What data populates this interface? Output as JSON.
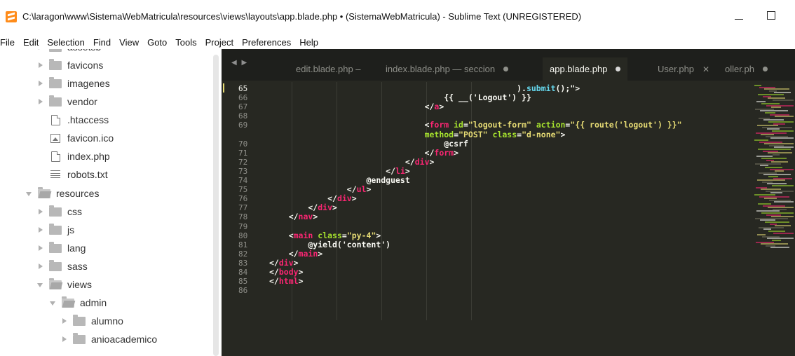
{
  "window": {
    "title": "C:\\laragon\\www\\SistemaWebMatricula\\resources\\views\\layouts\\app.blade.php • (SistemaWebMatricula) - Sublime Text (UNREGISTERED)"
  },
  "menu": [
    "File",
    "Edit",
    "Selection",
    "Find",
    "View",
    "Goto",
    "Tools",
    "Project",
    "Preferences",
    "Help"
  ],
  "sidebar": {
    "items": [
      {
        "label": "assetsb",
        "kind": "folder",
        "state": "collapsed"
      },
      {
        "label": "favicons",
        "kind": "folder",
        "state": "collapsed"
      },
      {
        "label": "imagenes",
        "kind": "folder",
        "state": "collapsed"
      },
      {
        "label": "vendor",
        "kind": "folder",
        "state": "collapsed"
      },
      {
        "label": ".htaccess",
        "kind": "file"
      },
      {
        "label": "favicon.ico",
        "kind": "image"
      },
      {
        "label": "index.php",
        "kind": "file"
      },
      {
        "label": "robots.txt",
        "kind": "text"
      },
      {
        "label": "resources",
        "kind": "folder",
        "state": "expanded"
      },
      {
        "label": "css",
        "kind": "folder",
        "state": "collapsed"
      },
      {
        "label": "js",
        "kind": "folder",
        "state": "collapsed"
      },
      {
        "label": "lang",
        "kind": "folder",
        "state": "collapsed"
      },
      {
        "label": "sass",
        "kind": "folder",
        "state": "collapsed"
      },
      {
        "label": "views",
        "kind": "folder",
        "state": "expanded"
      },
      {
        "label": "admin",
        "kind": "folder",
        "state": "expanded"
      },
      {
        "label": "alumno",
        "kind": "folder",
        "state": "collapsed"
      },
      {
        "label": "anioacademico",
        "kind": "folder",
        "state": "collapsed"
      }
    ]
  },
  "tabs": [
    {
      "label": "edit.blade.php –",
      "active": false,
      "marker": ""
    },
    {
      "label": "index.blade.php — seccion",
      "active": false,
      "marker": "dot"
    },
    {
      "label": "app.blade.php",
      "active": true,
      "marker": "dot"
    },
    {
      "label": "User.php",
      "active": false,
      "marker": "close"
    },
    {
      "label": "oller.ph",
      "active": false,
      "marker": "dot"
    }
  ],
  "tab_nav": "◀ ▶",
  "editor": {
    "line_numbers": [
      "65",
      "66",
      "67",
      "68",
      "69",
      "",
      "70",
      "71",
      "72",
      "73",
      "74",
      "75",
      "76",
      "77",
      "78",
      "79",
      "80",
      "81",
      "82",
      "83",
      "84",
      "85",
      "86"
    ],
    "current_line": "65",
    "lines": [
      [
        {
          "t": "                                                   ).",
          "c": ""
        },
        {
          "t": "submit",
          "c": "fn"
        },
        {
          "t": "();\">",
          "c": ""
        }
      ],
      [
        {
          "t": "                                    {{ __('Logout') }}",
          "c": ""
        }
      ],
      [
        {
          "t": "                                ",
          "c": ""
        },
        {
          "t": "</",
          "c": ""
        },
        {
          "t": "a",
          "c": "tag"
        },
        {
          "t": ">",
          "c": ""
        }
      ],
      [
        {
          "t": "",
          "c": ""
        }
      ],
      [
        {
          "t": "                                <",
          "c": ""
        },
        {
          "t": "form",
          "c": "tag"
        },
        {
          "t": " ",
          "c": ""
        },
        {
          "t": "id",
          "c": "attr"
        },
        {
          "t": "=",
          "c": ""
        },
        {
          "t": "\"logout-form\"",
          "c": "str"
        },
        {
          "t": " ",
          "c": ""
        },
        {
          "t": "action",
          "c": "attr"
        },
        {
          "t": "=",
          "c": ""
        },
        {
          "t": "\"{{ route('logout') }}\"",
          "c": "str"
        }
      ],
      [
        {
          "t": "                                ",
          "c": ""
        },
        {
          "t": "method",
          "c": "attr"
        },
        {
          "t": "=",
          "c": ""
        },
        {
          "t": "\"POST\"",
          "c": "str"
        },
        {
          "t": " ",
          "c": ""
        },
        {
          "t": "class",
          "c": "attr"
        },
        {
          "t": "=",
          "c": ""
        },
        {
          "t": "\"d-none\"",
          "c": "str"
        },
        {
          "t": ">",
          "c": ""
        }
      ],
      [
        {
          "t": "                                    @csrf",
          "c": ""
        }
      ],
      [
        {
          "t": "                                </",
          "c": ""
        },
        {
          "t": "form",
          "c": "tag"
        },
        {
          "t": ">",
          "c": ""
        }
      ],
      [
        {
          "t": "                            </",
          "c": ""
        },
        {
          "t": "div",
          "c": "tag"
        },
        {
          "t": ">",
          "c": ""
        }
      ],
      [
        {
          "t": "                        </",
          "c": ""
        },
        {
          "t": "li",
          "c": "tag"
        },
        {
          "t": ">",
          "c": ""
        }
      ],
      [
        {
          "t": "                    @endguest",
          "c": ""
        }
      ],
      [
        {
          "t": "                </",
          "c": ""
        },
        {
          "t": "ul",
          "c": "tag"
        },
        {
          "t": ">",
          "c": ""
        }
      ],
      [
        {
          "t": "            </",
          "c": ""
        },
        {
          "t": "div",
          "c": "tag"
        },
        {
          "t": ">",
          "c": ""
        }
      ],
      [
        {
          "t": "        </",
          "c": ""
        },
        {
          "t": "div",
          "c": "tag"
        },
        {
          "t": ">",
          "c": ""
        }
      ],
      [
        {
          "t": "    </",
          "c": ""
        },
        {
          "t": "nav",
          "c": "tag"
        },
        {
          "t": ">",
          "c": ""
        }
      ],
      [
        {
          "t": "",
          "c": ""
        }
      ],
      [
        {
          "t": "    <",
          "c": ""
        },
        {
          "t": "main",
          "c": "tag"
        },
        {
          "t": " ",
          "c": ""
        },
        {
          "t": "class",
          "c": "attr"
        },
        {
          "t": "=",
          "c": ""
        },
        {
          "t": "\"py-4\"",
          "c": "str"
        },
        {
          "t": ">",
          "c": ""
        }
      ],
      [
        {
          "t": "        @yield('content')",
          "c": ""
        }
      ],
      [
        {
          "t": "    </",
          "c": ""
        },
        {
          "t": "main",
          "c": "tag"
        },
        {
          "t": ">",
          "c": ""
        }
      ],
      [
        {
          "t": "</",
          "c": ""
        },
        {
          "t": "div",
          "c": "tag"
        },
        {
          "t": ">",
          "c": ""
        }
      ],
      [
        {
          "t": "</",
          "c": ""
        },
        {
          "t": "body",
          "c": "tag"
        },
        {
          "t": ">",
          "c": ""
        }
      ],
      [
        {
          "t": "</",
          "c": ""
        },
        {
          "t": "html",
          "c": "tag"
        },
        {
          "t": ">",
          "c": ""
        }
      ],
      [
        {
          "t": "",
          "c": ""
        }
      ]
    ]
  },
  "colors": {
    "editor_bg": "#272822",
    "tag": "#f92672",
    "attr": "#a6e22e",
    "string": "#e6db74",
    "function": "#66d9ef",
    "app_icon": "#ff8c1a"
  }
}
